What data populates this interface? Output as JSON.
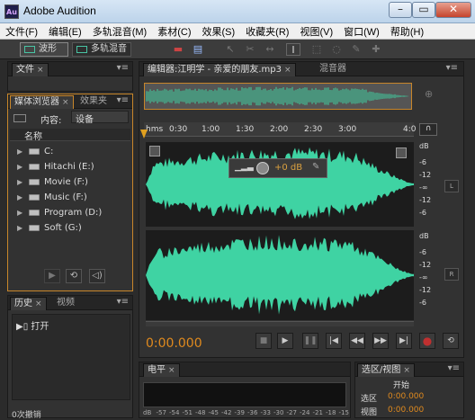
{
  "window": {
    "icon_text": "Au",
    "title": "Adobe Audition"
  },
  "menu": [
    "文件(F)",
    "编辑(E)",
    "多轨混音(M)",
    "素材(C)",
    "效果(S)",
    "收藏夹(R)",
    "视图(V)",
    "窗口(W)",
    "帮助(H)"
  ],
  "toolbar": {
    "waveform_label": "波形",
    "multitrack_label": "多轨混音"
  },
  "files_panel": {
    "tab": "文件"
  },
  "media_browser": {
    "tabs": [
      "媒体浏览器",
      "效果夹"
    ],
    "content_label": "内容:",
    "content_value": "设备",
    "column_header": "名称",
    "drives": [
      "C:",
      "Hitachi (E:)",
      "Movie (F:)",
      "Music (F:)",
      "Program (D:)",
      "Soft (G:)"
    ]
  },
  "history_panel": {
    "tabs": [
      "历史",
      "视频"
    ],
    "entries": [
      "打开"
    ],
    "undo_count": "0次撤销"
  },
  "editor": {
    "tabs": [
      "编辑器:江明学 - 亲爱的朋友.mp3",
      "混音器"
    ],
    "ruler": [
      "hms",
      "0:30",
      "1:00",
      "1:30",
      "2:00",
      "2:30",
      "3:00",
      "4:0"
    ],
    "hud_gain": "+0 dB",
    "scale_top": [
      "dB",
      "-6",
      "-12",
      "-∞",
      "-12",
      "-6"
    ],
    "scale_bottom": [
      "dB",
      "-6",
      "-12",
      "-∞",
      "-12",
      "-6"
    ],
    "channel_left": "L",
    "channel_right": "R",
    "time_display": "0:00.000",
    "colors": {
      "waveform": "#3fd3a3",
      "time": "#e08a1e",
      "record": "#c03030"
    }
  },
  "levels_panel": {
    "tab": "电平",
    "ticks": [
      "dB",
      "-57",
      "-54",
      "-51",
      "-48",
      "-45",
      "-42",
      "-39",
      "-36",
      "-33",
      "-30",
      "-27",
      "-24",
      "-21",
      "-18",
      "-15"
    ]
  },
  "range_panel": {
    "tab": "选区/视图",
    "col_start": "开始",
    "row_selection": "选区",
    "row_view": "视图",
    "selection_start": "0:00.000",
    "view_start": "0:00.000"
  }
}
